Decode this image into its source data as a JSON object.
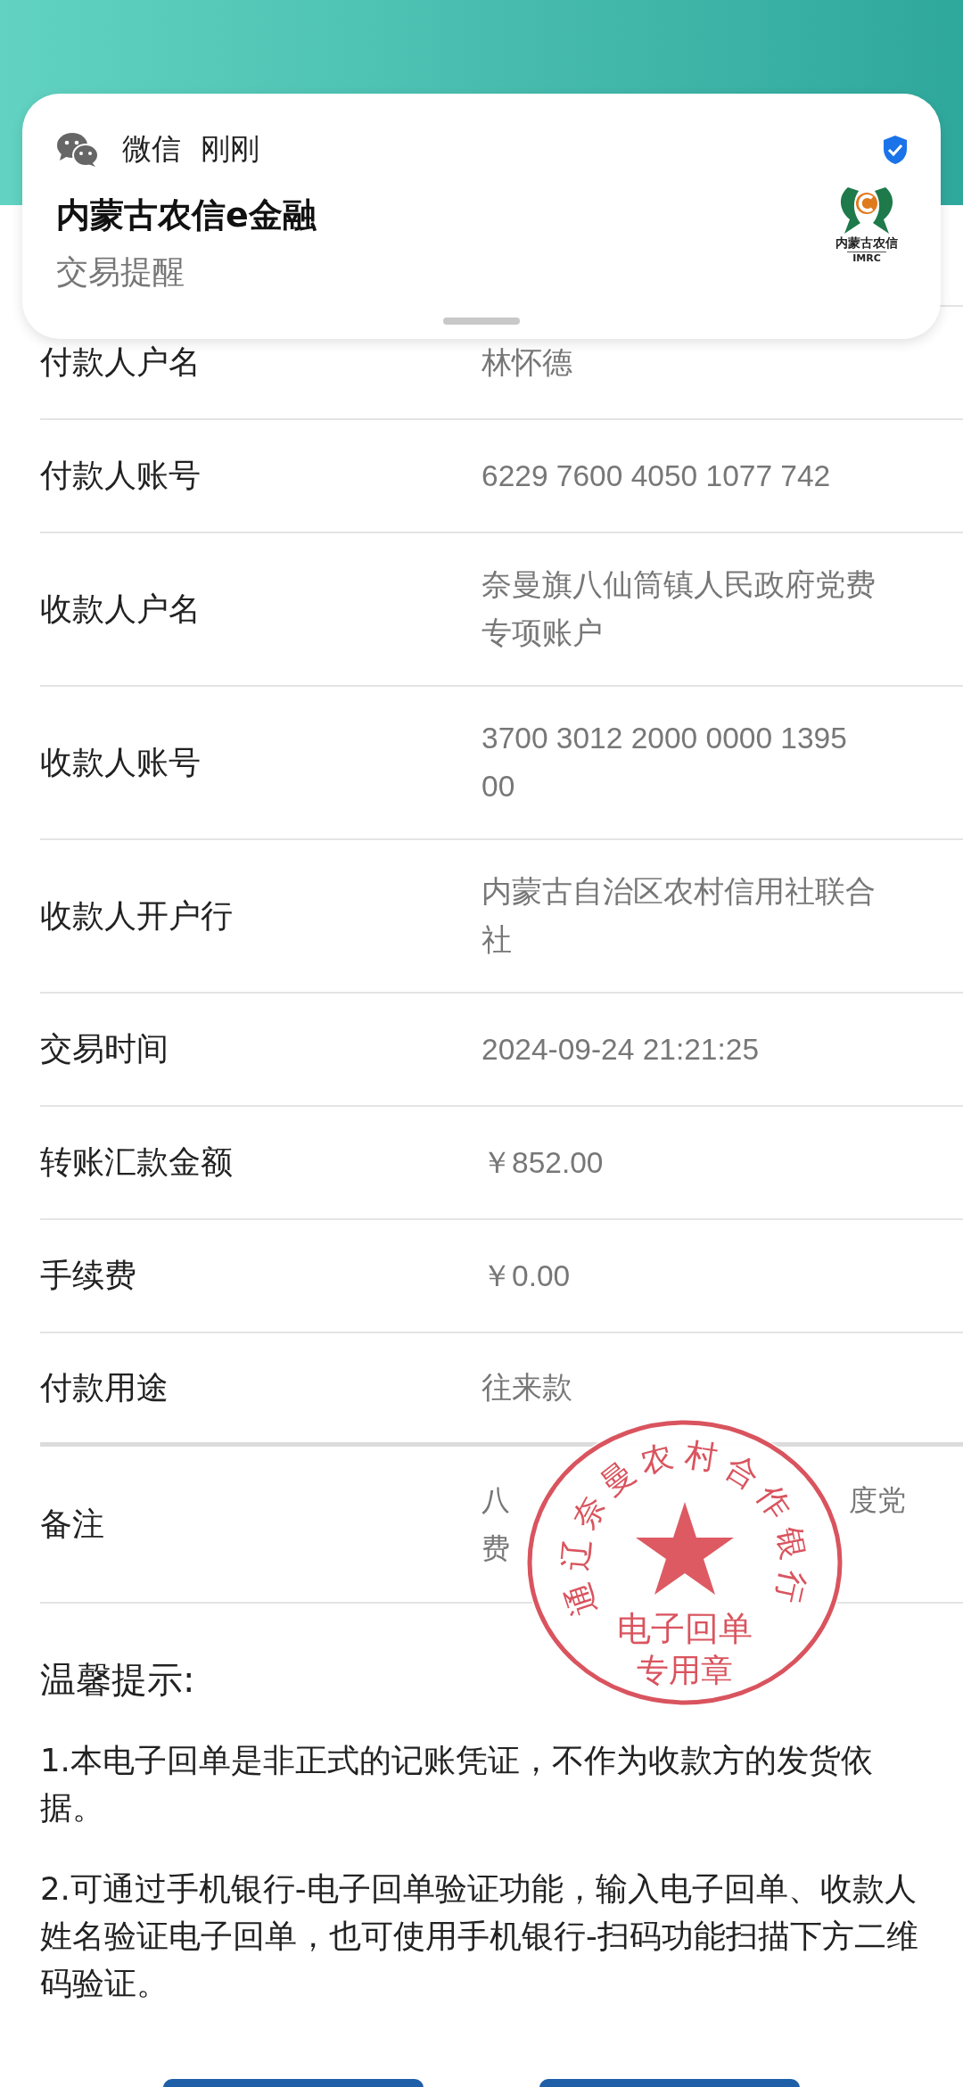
{
  "notification": {
    "app": "微信",
    "time": "刚刚",
    "verified": true,
    "title": "内蒙古农信e金融",
    "subtitle": "交易提醒",
    "logo_text": "内蒙古农信",
    "logo_sub": "IMRC"
  },
  "rows": [
    {
      "label": "付款人户名",
      "value": "林怀德"
    },
    {
      "label": "付款人账号",
      "value": "6229 7600 4050 1077 742"
    },
    {
      "label": "收款人户名",
      "value": "奈曼旗八仙筒镇人民政府党费专项账户"
    },
    {
      "label": "收款人账号",
      "value": "3700 3012 2000 0000 1395 00"
    },
    {
      "label": "收款人开户行",
      "value": "内蒙古自治区农村信用社联合社"
    },
    {
      "label": "交易时间",
      "value": "2024-09-24 21:21:25"
    },
    {
      "label": "转账汇款金额",
      "value": "￥852.00"
    },
    {
      "label": "手续费",
      "value": "￥0.00"
    },
    {
      "label": "付款用途",
      "value": "往来款"
    }
  ],
  "remark": {
    "label": "备注",
    "fragments": [
      [
        "八",
        "度党"
      ],
      [
        "费"
      ]
    ]
  },
  "stamp": {
    "ring": "通辽奈曼农村合作银行",
    "line_1": "电子回单",
    "line_2": "专用章"
  },
  "tips": {
    "title": "温馨提示:",
    "items": [
      "1.本电子回单是非正式的记账凭证，不作为收款方的发货依据。",
      "2.可通过手机银行-电子回单验证功能，输入电子回单、收款人姓名验证电子回单，也可使用手机银行-扫码功能扫描下方二维码验证。"
    ]
  }
}
